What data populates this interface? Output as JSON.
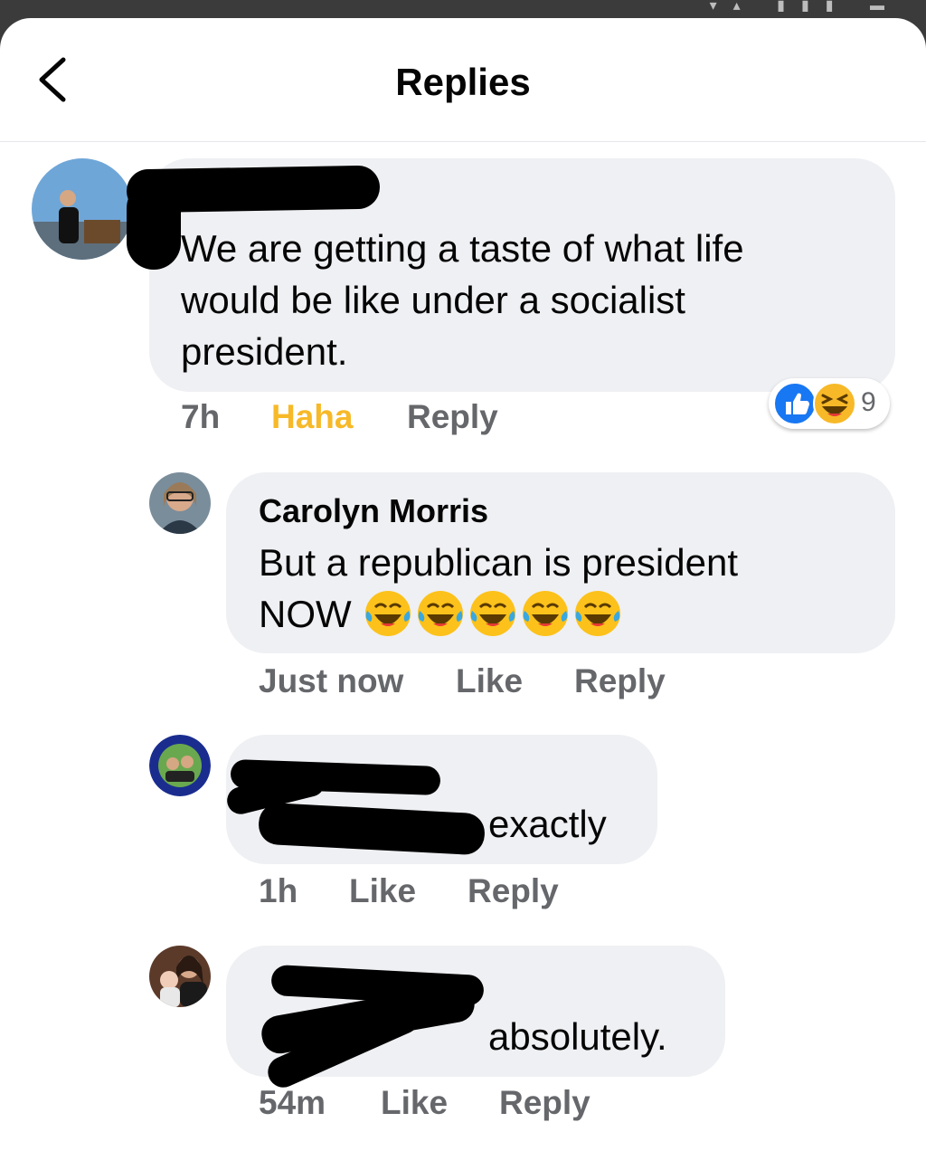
{
  "header": {
    "title": "Replies"
  },
  "comments": [
    {
      "name": "",
      "text_lines": [
        "We are getting a taste of what life",
        "would be like under a socialist",
        "president."
      ],
      "time": "7h",
      "reaction_label": "Haha",
      "reply_label": "Reply",
      "reaction_count": "9",
      "reaction_icons": [
        "like-icon",
        "haha-icon"
      ]
    },
    {
      "name": "Carolyn Morris",
      "text_lines": [
        "But a republican is president",
        "NOW"
      ],
      "emojis": [
        "tears-of-joy-emoji",
        "tears-of-joy-emoji",
        "tears-of-joy-emoji",
        "tears-of-joy-emoji",
        "tears-of-joy-emoji"
      ],
      "time": "Just now",
      "like_label": "Like",
      "reply_label": "Reply"
    },
    {
      "text": "exactly",
      "time": "1h",
      "like_label": "Like",
      "reply_label": "Reply"
    },
    {
      "text": "absolutely.",
      "time": "54m",
      "like_label": "Like",
      "reply_label": "Reply"
    }
  ],
  "colors": {
    "bubble": "#eff0f3",
    "meta_text": "#65676b",
    "haha_active": "#f7b928",
    "like_blue": "#1877f2"
  }
}
